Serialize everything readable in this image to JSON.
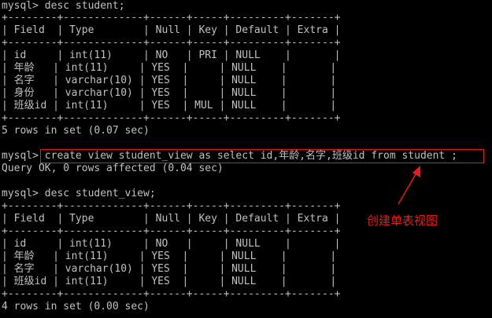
{
  "terminal": {
    "text_color": "#c0c0c0",
    "background": "#000000",
    "lines": [
      "mysql> desc student;",
      "+--------+-------------+------+-----+---------+-------+",
      "| Field  | Type        | Null | Key | Default | Extra |",
      "+--------+-------------+------+-----+---------+-------+",
      "| id     | int(11)     | NO   | PRI | NULL    |       |",
      "| 年龄   | int(11)     | YES  |     | NULL    |       |",
      "| 名字   | varchar(10) | YES  |     | NULL    |       |",
      "| 身份   | varchar(10) | YES  |     | NULL    |       |",
      "| 班级id | int(11)     | YES  | MUL | NULL    |       |",
      "+--------+-------------+------+-----+---------+-------+",
      "5 rows in set (0.07 sec)",
      "",
      "mysql> create view student_view as select id,年龄,名字,班级id from student ;",
      "Query OK, 0 rows affected (0.04 sec)",
      "",
      "mysql> desc student_view;",
      "+--------+-------------+------+-----+---------+-------+",
      "| Field  | Type        | Null | Key | Default | Extra |",
      "+--------+-------------+------+-----+---------+-------+",
      "| id     | int(11)     | NO   |     | NULL    |       |",
      "| 年龄   | int(11)     | YES  |     | NULL    |       |",
      "| 名字   | varchar(10) | YES  |     | NULL    |       |",
      "| 班级id | int(11)     | YES  |     | NULL    |       |",
      "+--------+-------------+------+-----+---------+-------+",
      "4 rows in set (0.00 sec)"
    ]
  },
  "annotation": {
    "text": "创建单表视图",
    "color": "#e81b1b"
  }
}
